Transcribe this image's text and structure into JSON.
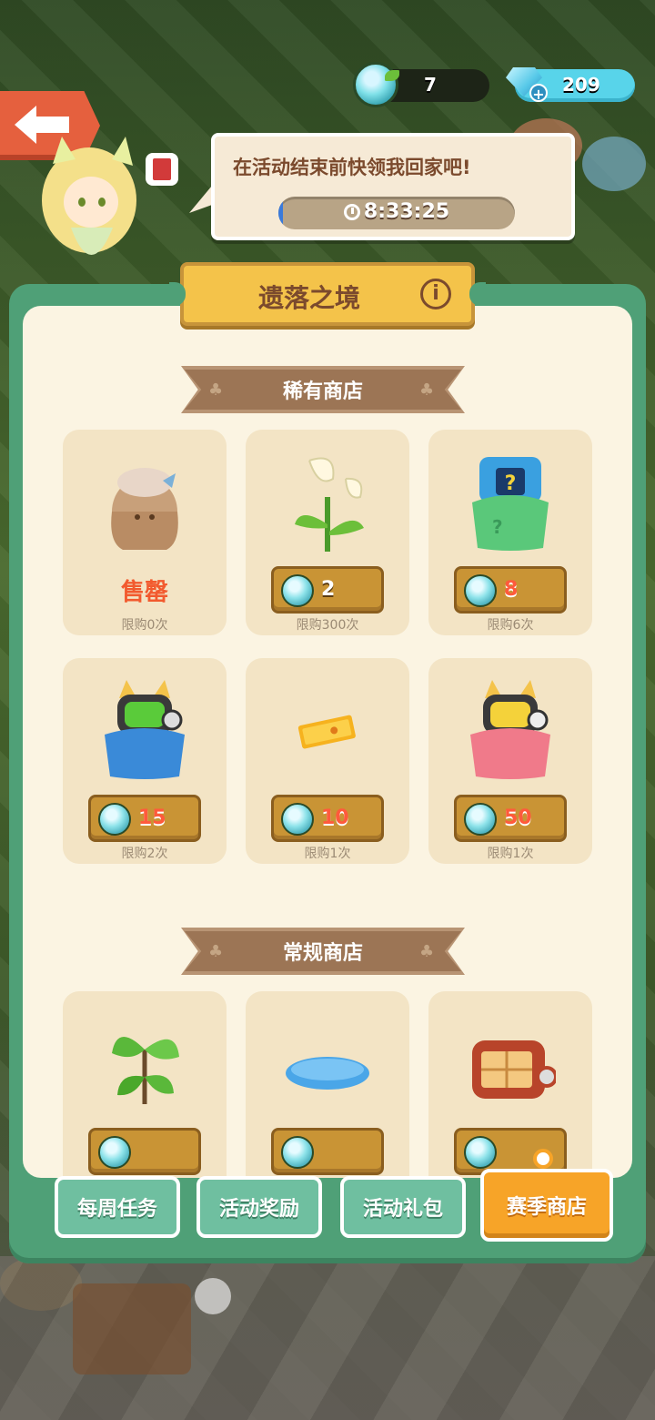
{
  "resources": {
    "seeds": "7",
    "gems": "209"
  },
  "event": {
    "message": "在活动结束前快领我回家吧!",
    "countdown": "8:33:25",
    "progress": 0.02
  },
  "shop": {
    "title": "遗落之境",
    "rare_section": "稀有商店",
    "regular_section": "常规商店",
    "rare_items": [
      {
        "name": "doll",
        "soldout": "售罄",
        "limit": "限购0次"
      },
      {
        "name": "calla-lily",
        "price": "2",
        "limit": "限购300次"
      },
      {
        "name": "blue-mystery-bag",
        "price": "8",
        "limit": "限购6次"
      },
      {
        "name": "green-cat-bag",
        "price": "15",
        "limit": "限购2次"
      },
      {
        "name": "ticket",
        "price": "10",
        "limit": "限购1次"
      },
      {
        "name": "red-cat-bag",
        "price": "50",
        "limit": "限购1次"
      }
    ],
    "regular_items": [
      {
        "name": "herb-plant"
      },
      {
        "name": "water-puddle"
      },
      {
        "name": "radio-box"
      }
    ]
  },
  "tabs": [
    {
      "label": "每周任务",
      "active": false
    },
    {
      "label": "活动奖励",
      "active": false
    },
    {
      "label": "活动礼包",
      "active": false
    },
    {
      "label": "赛季商店",
      "active": true
    }
  ],
  "colors": {
    "panel": "#4fa077",
    "accent": "#f7a428",
    "price_red": "#ff5a3c",
    "soldout": "#f25a2e"
  }
}
